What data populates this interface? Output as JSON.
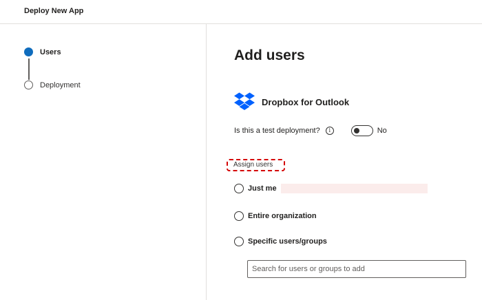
{
  "window": {
    "title": "Deploy New App"
  },
  "steps": [
    {
      "label": "Users",
      "state": "active"
    },
    {
      "label": "Deployment",
      "state": "inactive"
    }
  ],
  "main": {
    "heading": "Add users",
    "app": {
      "name": "Dropbox for Outlook",
      "icon": "dropbox-icon"
    },
    "test_deployment": {
      "question": "Is this a test deployment?",
      "info_icon": "info-icon",
      "toggle_state": "No"
    },
    "assign_users": {
      "label": "Assign users",
      "options": [
        {
          "label": "Just me"
        },
        {
          "label": "Entire organization"
        },
        {
          "label": "Specific users/groups"
        }
      ]
    },
    "search": {
      "placeholder": "Search for users or groups to add",
      "value": ""
    }
  },
  "colors": {
    "accent": "#0f6cbd",
    "dropbox": "#0061fe",
    "highlight": "#d40000"
  }
}
